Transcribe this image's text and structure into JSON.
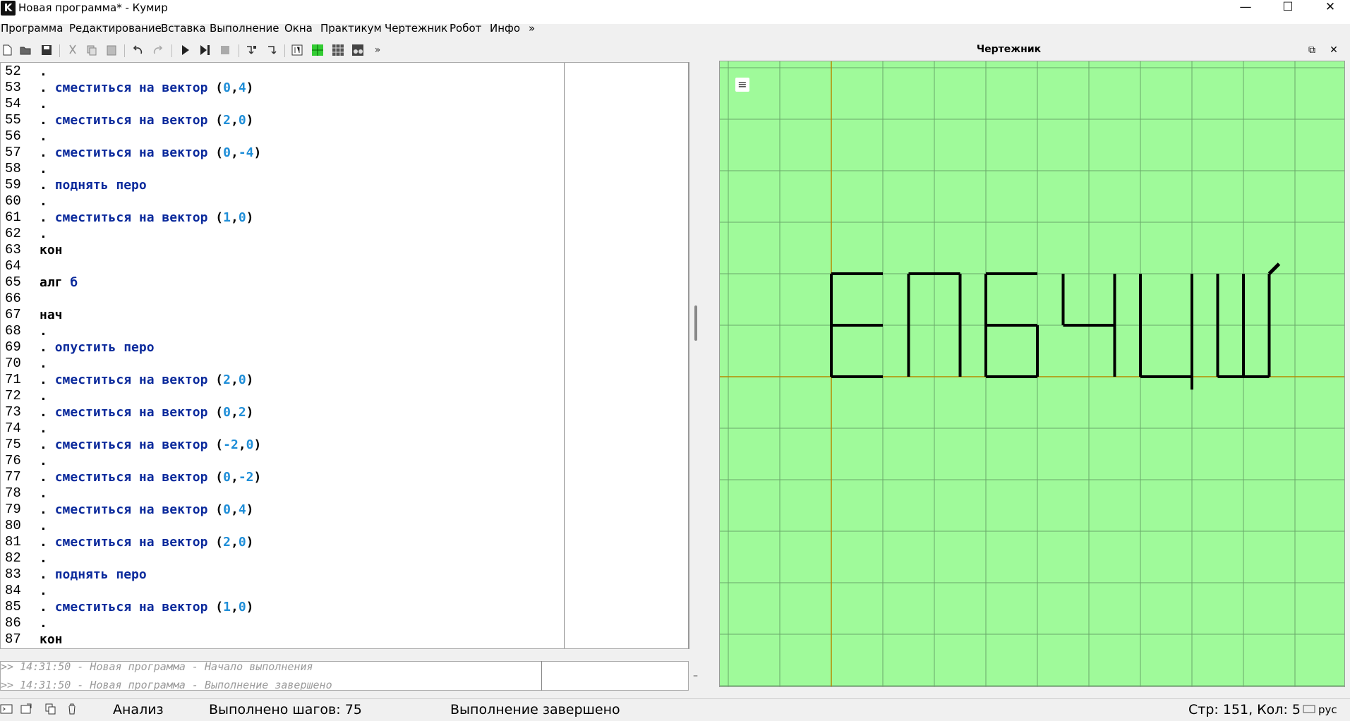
{
  "window": {
    "icon_letter": "K",
    "title": "Новая программа* - Кумир",
    "minimize_glyph": "—",
    "maximize_glyph": "☐",
    "close_glyph": "✕"
  },
  "menu": [
    "Программа",
    "Редактирование",
    "Вставка",
    "Выполнение",
    "Окна",
    "Практикум",
    "Чертежник",
    "Робот",
    "Инфо",
    "»"
  ],
  "toolbar": {
    "overflow": "»"
  },
  "editor": {
    "lines": [
      {
        "n": "52",
        "parts": [
          {
            "t": ".",
            "c": "kw-black"
          }
        ]
      },
      {
        "n": "53",
        "parts": [
          {
            "t": ". ",
            "c": "kw-black"
          },
          {
            "t": "сместиться на вектор",
            "c": "kw-blue"
          },
          {
            "t": " (",
            "c": "paren"
          },
          {
            "t": "0",
            "c": "num"
          },
          {
            "t": ",",
            "c": "paren"
          },
          {
            "t": "4",
            "c": "num"
          },
          {
            "t": ")",
            "c": "paren"
          }
        ]
      },
      {
        "n": "54",
        "parts": [
          {
            "t": ".",
            "c": "kw-black"
          }
        ]
      },
      {
        "n": "55",
        "parts": [
          {
            "t": ". ",
            "c": "kw-black"
          },
          {
            "t": "сместиться на вектор",
            "c": "kw-blue"
          },
          {
            "t": " (",
            "c": "paren"
          },
          {
            "t": "2",
            "c": "num"
          },
          {
            "t": ",",
            "c": "paren"
          },
          {
            "t": "0",
            "c": "num"
          },
          {
            "t": ")",
            "c": "paren"
          }
        ]
      },
      {
        "n": "56",
        "parts": [
          {
            "t": ".",
            "c": "kw-black"
          }
        ]
      },
      {
        "n": "57",
        "parts": [
          {
            "t": ". ",
            "c": "kw-black"
          },
          {
            "t": "сместиться на вектор",
            "c": "kw-blue"
          },
          {
            "t": " (",
            "c": "paren"
          },
          {
            "t": "0",
            "c": "num"
          },
          {
            "t": ",",
            "c": "paren"
          },
          {
            "t": "-4",
            "c": "num"
          },
          {
            "t": ")",
            "c": "paren"
          }
        ]
      },
      {
        "n": "58",
        "parts": [
          {
            "t": ".",
            "c": "kw-black"
          }
        ]
      },
      {
        "n": "59",
        "parts": [
          {
            "t": ". ",
            "c": "kw-black"
          },
          {
            "t": "поднять перо",
            "c": "kw-blue"
          }
        ]
      },
      {
        "n": "60",
        "parts": [
          {
            "t": ".",
            "c": "kw-black"
          }
        ]
      },
      {
        "n": "61",
        "parts": [
          {
            "t": ". ",
            "c": "kw-black"
          },
          {
            "t": "сместиться на вектор",
            "c": "kw-blue"
          },
          {
            "t": " (",
            "c": "paren"
          },
          {
            "t": "1",
            "c": "num"
          },
          {
            "t": ",",
            "c": "paren"
          },
          {
            "t": "0",
            "c": "num"
          },
          {
            "t": ")",
            "c": "paren"
          }
        ]
      },
      {
        "n": "62",
        "parts": [
          {
            "t": ".",
            "c": "kw-black"
          }
        ]
      },
      {
        "n": "63",
        "parts": [
          {
            "t": "кон",
            "c": "kw-black"
          }
        ]
      },
      {
        "n": "64",
        "parts": []
      },
      {
        "n": "65",
        "parts": [
          {
            "t": "алг ",
            "c": "kw-black"
          },
          {
            "t": "б",
            "c": "kw-blue"
          }
        ]
      },
      {
        "n": "66",
        "parts": []
      },
      {
        "n": "67",
        "parts": [
          {
            "t": "нач",
            "c": "kw-black"
          }
        ]
      },
      {
        "n": "68",
        "parts": [
          {
            "t": ".",
            "c": "kw-black"
          }
        ]
      },
      {
        "n": "69",
        "parts": [
          {
            "t": ". ",
            "c": "kw-black"
          },
          {
            "t": "опустить перо",
            "c": "kw-blue"
          }
        ]
      },
      {
        "n": "70",
        "parts": [
          {
            "t": ".",
            "c": "kw-black"
          }
        ]
      },
      {
        "n": "71",
        "parts": [
          {
            "t": ". ",
            "c": "kw-black"
          },
          {
            "t": "сместиться на вектор",
            "c": "kw-blue"
          },
          {
            "t": " (",
            "c": "paren"
          },
          {
            "t": "2",
            "c": "num"
          },
          {
            "t": ",",
            "c": "paren"
          },
          {
            "t": "0",
            "c": "num"
          },
          {
            "t": ")",
            "c": "paren"
          }
        ]
      },
      {
        "n": "72",
        "parts": [
          {
            "t": ".",
            "c": "kw-black"
          }
        ]
      },
      {
        "n": "73",
        "parts": [
          {
            "t": ". ",
            "c": "kw-black"
          },
          {
            "t": "сместиться на вектор",
            "c": "kw-blue"
          },
          {
            "t": " (",
            "c": "paren"
          },
          {
            "t": "0",
            "c": "num"
          },
          {
            "t": ",",
            "c": "paren"
          },
          {
            "t": "2",
            "c": "num"
          },
          {
            "t": ")",
            "c": "paren"
          }
        ]
      },
      {
        "n": "74",
        "parts": [
          {
            "t": ".",
            "c": "kw-black"
          }
        ]
      },
      {
        "n": "75",
        "parts": [
          {
            "t": ". ",
            "c": "kw-black"
          },
          {
            "t": "сместиться на вектор",
            "c": "kw-blue"
          },
          {
            "t": " (",
            "c": "paren"
          },
          {
            "t": "-2",
            "c": "num"
          },
          {
            "t": ",",
            "c": "paren"
          },
          {
            "t": "0",
            "c": "num"
          },
          {
            "t": ")",
            "c": "paren"
          }
        ]
      },
      {
        "n": "76",
        "parts": [
          {
            "t": ".",
            "c": "kw-black"
          }
        ]
      },
      {
        "n": "77",
        "parts": [
          {
            "t": ". ",
            "c": "kw-black"
          },
          {
            "t": "сместиться на вектор",
            "c": "kw-blue"
          },
          {
            "t": " (",
            "c": "paren"
          },
          {
            "t": "0",
            "c": "num"
          },
          {
            "t": ",",
            "c": "paren"
          },
          {
            "t": "-2",
            "c": "num"
          },
          {
            "t": ")",
            "c": "paren"
          }
        ]
      },
      {
        "n": "78",
        "parts": [
          {
            "t": ".",
            "c": "kw-black"
          }
        ]
      },
      {
        "n": "79",
        "parts": [
          {
            "t": ". ",
            "c": "kw-black"
          },
          {
            "t": "сместиться на вектор",
            "c": "kw-blue"
          },
          {
            "t": " (",
            "c": "paren"
          },
          {
            "t": "0",
            "c": "num"
          },
          {
            "t": ",",
            "c": "paren"
          },
          {
            "t": "4",
            "c": "num"
          },
          {
            "t": ")",
            "c": "paren"
          }
        ]
      },
      {
        "n": "80",
        "parts": [
          {
            "t": ".",
            "c": "kw-black"
          }
        ]
      },
      {
        "n": "81",
        "parts": [
          {
            "t": ". ",
            "c": "kw-black"
          },
          {
            "t": "сместиться на вектор",
            "c": "kw-blue"
          },
          {
            "t": " (",
            "c": "paren"
          },
          {
            "t": "2",
            "c": "num"
          },
          {
            "t": ",",
            "c": "paren"
          },
          {
            "t": "0",
            "c": "num"
          },
          {
            "t": ")",
            "c": "paren"
          }
        ]
      },
      {
        "n": "82",
        "parts": [
          {
            "t": ".",
            "c": "kw-black"
          }
        ]
      },
      {
        "n": "83",
        "parts": [
          {
            "t": ". ",
            "c": "kw-black"
          },
          {
            "t": "поднять перо",
            "c": "kw-blue"
          }
        ]
      },
      {
        "n": "84",
        "parts": [
          {
            "t": ".",
            "c": "kw-black"
          }
        ]
      },
      {
        "n": "85",
        "parts": [
          {
            "t": ". ",
            "c": "kw-black"
          },
          {
            "t": "сместиться на вектор",
            "c": "kw-blue"
          },
          {
            "t": " (",
            "c": "paren"
          },
          {
            "t": "1",
            "c": "num"
          },
          {
            "t": ",",
            "c": "paren"
          },
          {
            "t": "0",
            "c": "num"
          },
          {
            "t": ")",
            "c": "paren"
          }
        ]
      },
      {
        "n": "86",
        "parts": [
          {
            "t": ".",
            "c": "kw-black"
          }
        ]
      },
      {
        "n": "87",
        "parts": [
          {
            "t": "кон",
            "c": "kw-black"
          }
        ]
      }
    ]
  },
  "console": {
    "lines": [
      ">> 14:31:50 - Новая программа - Начало выполнения",
      ">> 14:31:50 - Новая программа - Выполнение завершено"
    ],
    "side_mark": "–"
  },
  "drawer": {
    "title": "Чертежник",
    "float_glyph": "⧉",
    "close_glyph": "✕",
    "menu_glyph": "≡",
    "background": "#9ffa9a",
    "grid_color": "#6aa86a",
    "axis_color": "#b58a00",
    "pen_color": "#000000"
  },
  "statusbar": {
    "mode": "Анализ",
    "steps": "Выполнено шагов: 75",
    "state": "Выполнение завершено",
    "position": "Стр: 151, Кол: 5",
    "keyboard": "рус"
  }
}
